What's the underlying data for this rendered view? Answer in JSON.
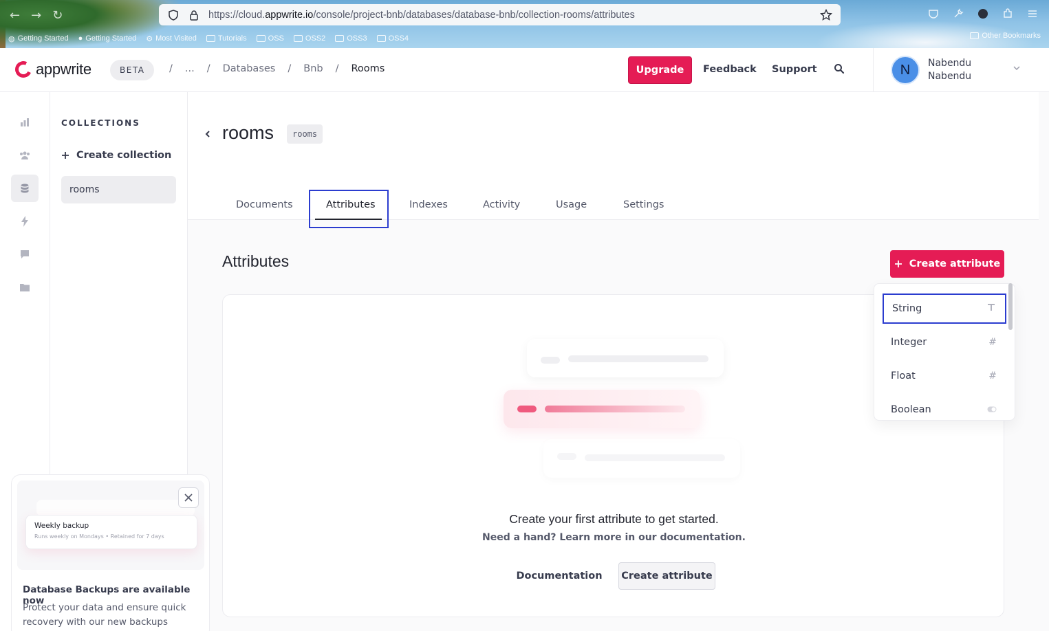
{
  "browser": {
    "url_prefix": "https://cloud.",
    "url_domain": "appwrite.io",
    "url_path": "/console/project-bnb/databases/database-bnb/collection-rooms/attributes",
    "bookmarks": [
      "Getting Started",
      "Getting Started",
      "Most Visited",
      "Tutorials",
      "OSS",
      "OSS2",
      "OSS3",
      "OSS4"
    ],
    "other_bookmarks": "Other Bookmarks"
  },
  "header": {
    "logo_text": "appwrite",
    "beta_label": "BETA",
    "breadcrumbs": [
      "/",
      "...",
      "/",
      "Databases",
      "/",
      "Bnb",
      "/",
      "Rooms"
    ],
    "upgrade_label": "Upgrade",
    "feedback_label": "Feedback",
    "support_label": "Support",
    "user": {
      "initial": "N",
      "name_line1": "Nabendu",
      "name_line2": "Nabendu"
    }
  },
  "collections_panel": {
    "title": "COLLECTIONS",
    "create_label": "Create collection",
    "items": [
      "rooms"
    ]
  },
  "promo": {
    "card_title": "Weekly backup",
    "card_subtitle": "Runs weekly on Mondays • Retained for 7 days",
    "title": "Database Backups are available now",
    "description": "Protect your data and ensure quick recovery with our new backups"
  },
  "page": {
    "title": "rooms",
    "id_badge": "rooms",
    "tabs": [
      "Documents",
      "Attributes",
      "Indexes",
      "Activity",
      "Usage",
      "Settings"
    ],
    "active_tab": "Attributes"
  },
  "attributes": {
    "section_title": "Attributes",
    "create_button": "Create attribute",
    "empty_heading": "Create your first attribute to get started.",
    "empty_sub": "Need a hand? Learn more in our documentation.",
    "documentation_button": "Documentation",
    "create_button_secondary": "Create attribute"
  },
  "attribute_menu": {
    "items": [
      {
        "label": "String",
        "icon": "text-icon"
      },
      {
        "label": "Integer",
        "icon": "hash-icon"
      },
      {
        "label": "Float",
        "icon": "hash-icon"
      },
      {
        "label": "Boolean",
        "icon": "toggle-icon"
      }
    ]
  },
  "colors": {
    "brand": "#e51c55",
    "highlight": "#2b3ccf"
  }
}
